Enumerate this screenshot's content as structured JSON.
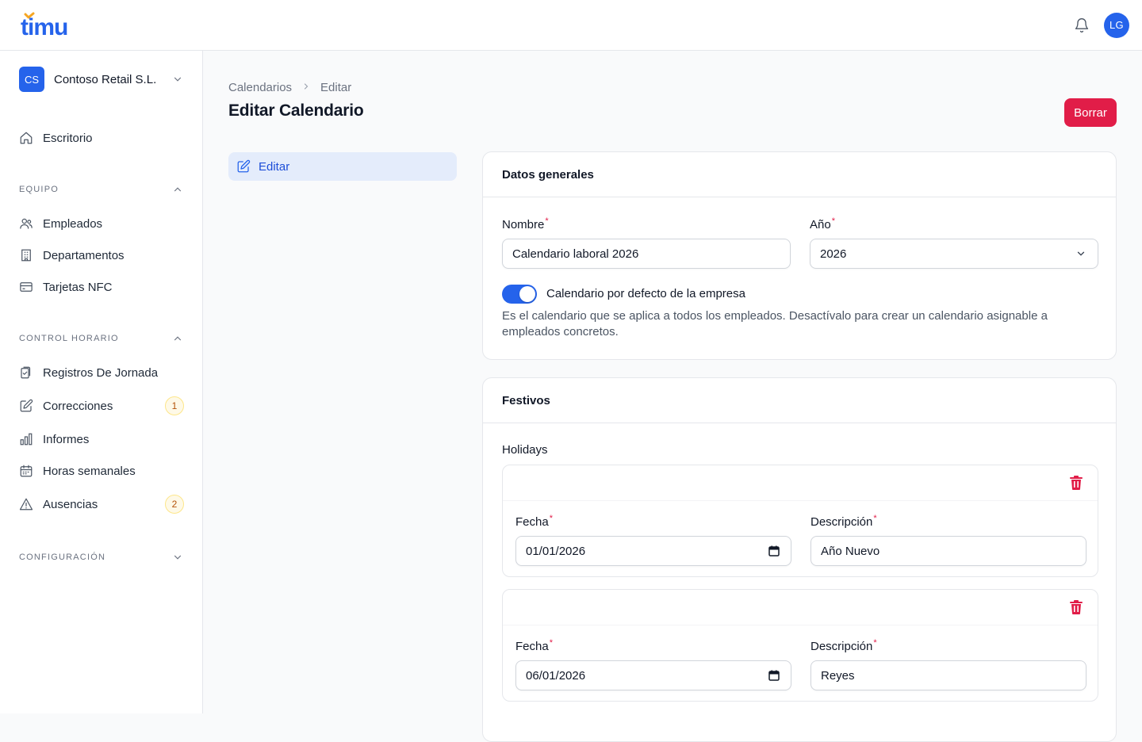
{
  "app": {
    "logo_text": "timu",
    "user_initials": "LG"
  },
  "tenant": {
    "initials": "CS",
    "name": "Contoso Retail S.L."
  },
  "sidebar": {
    "dashboard": {
      "label": "Escritorio"
    },
    "groups": [
      {
        "title": "EQUIPO",
        "expanded": true
      },
      {
        "title": "CONTROL HORARIO",
        "expanded": true
      },
      {
        "title": "CONFIGURACIÓN",
        "expanded": false
      }
    ],
    "equipo_items": [
      {
        "label": "Empleados",
        "icon": "users-icon"
      },
      {
        "label": "Departamentos",
        "icon": "building-icon"
      },
      {
        "label": "Tarjetas NFC",
        "icon": "credit-card-icon"
      }
    ],
    "control_items": [
      {
        "label": "Registros De Jornada",
        "icon": "clipboard-check-icon"
      },
      {
        "label": "Correcciones",
        "icon": "pencil-square-icon",
        "badge": "1"
      },
      {
        "label": "Informes",
        "icon": "bar-chart-icon"
      },
      {
        "label": "Horas semanales",
        "icon": "calendar-icon"
      },
      {
        "label": "Ausencias",
        "icon": "warning-triangle-icon",
        "badge": "2"
      }
    ]
  },
  "breadcrumb": [
    "Calendarios",
    "Editar"
  ],
  "page": {
    "title": "Editar Calendario",
    "delete_label": "Borrar"
  },
  "subnav": {
    "label": "Editar"
  },
  "general": {
    "heading": "Datos generales",
    "name_label": "Nombre",
    "name_value": "Calendario laboral 2026",
    "year_label": "Año",
    "year_value": "2026",
    "toggle_label": "Calendario por defecto de la empresa",
    "toggle_on": true,
    "help_text": "Es el calendario que se aplica a todos los empleados. Desactívalo para crear un calendario asignable a empleados concretos."
  },
  "holidays": {
    "heading": "Festivos",
    "list_label": "Holidays",
    "date_label": "Fecha",
    "desc_label": "Descripción",
    "items": [
      {
        "date": "01/01/2026",
        "description": "Año Nuevo"
      },
      {
        "date": "06/01/2026",
        "description": "Reyes"
      }
    ]
  },
  "colors": {
    "primary": "#2563eb",
    "danger": "#e11d48",
    "logo_accent": "#f5a623"
  }
}
